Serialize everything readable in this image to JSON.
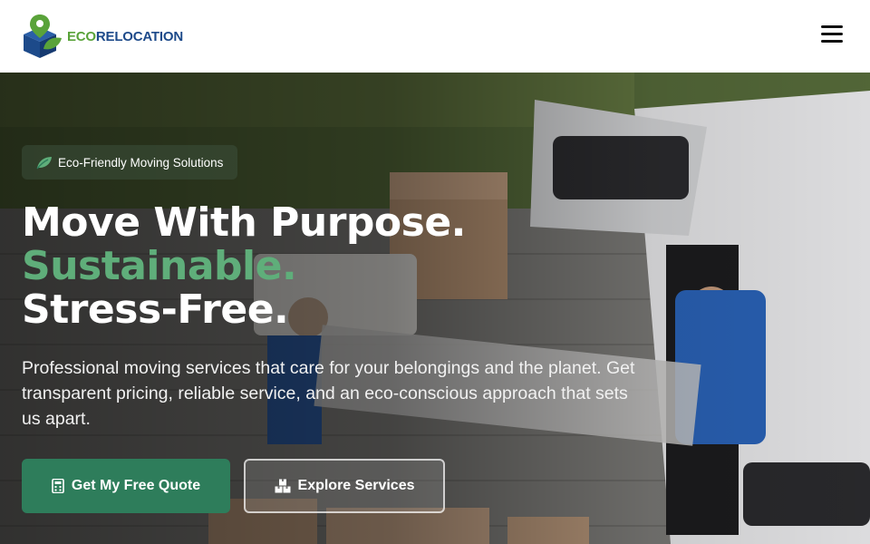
{
  "brand": {
    "eco": "ECO",
    "relocation": "RELOCATION",
    "colors": {
      "green": "#5aa33a",
      "blue": "#1d4a8a",
      "accent": "#2e7d5b",
      "headline_green": "#5fae7a"
    }
  },
  "header": {
    "menu_icon": "hamburger-menu-icon"
  },
  "hero": {
    "badge": {
      "icon": "leaf-icon",
      "label": "Eco-Friendly Moving Solutions"
    },
    "headline": {
      "line1": "Move With Purpose.",
      "line2": "Sustainable.",
      "line3": "Stress-Free."
    },
    "subtext": "Professional moving services that care for your belongings and the planet. Get transparent pricing, reliable service, and an eco-conscious approach that sets us apart.",
    "primary_button": {
      "icon": "calculator-icon",
      "label": "Get My Free Quote"
    },
    "secondary_button": {
      "icon": "boxes-icon",
      "label": "Explore Services"
    }
  }
}
